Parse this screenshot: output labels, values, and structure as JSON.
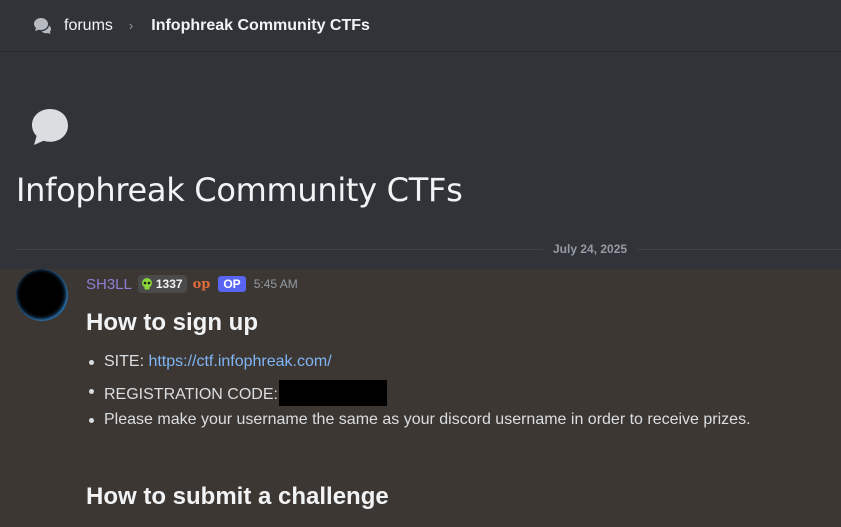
{
  "breadcrumb": {
    "forums_label": "forums",
    "separator": "›",
    "title": "Infophreak Community CTFs"
  },
  "hero": {
    "title": "Infophreak Community CTFs",
    "bubble_icon": "speech-bubble-icon"
  },
  "date_divider": "July 24, 2025",
  "message": {
    "username": "SH3LL",
    "clan_tag": "1337",
    "role_icon": "op",
    "op_badge": "OP",
    "timestamp": "5:45 AM",
    "heading_signup": "How to sign up",
    "bullets": [
      {
        "prefix": "SITE: ",
        "link": "https://ctf.infophreak.com/"
      },
      {
        "prefix": "REGISTRATION CODE:"
      },
      {
        "prefix": "Please make your username the same as your discord username in order to receive prizes."
      }
    ],
    "heading_submit": "How to submit a challenge"
  },
  "colors": {
    "background": "#313338",
    "message_highlight": "#3c3733",
    "username": "#8d7fd6",
    "op_badge": "#5865f2",
    "link": "#7fb5f5"
  }
}
